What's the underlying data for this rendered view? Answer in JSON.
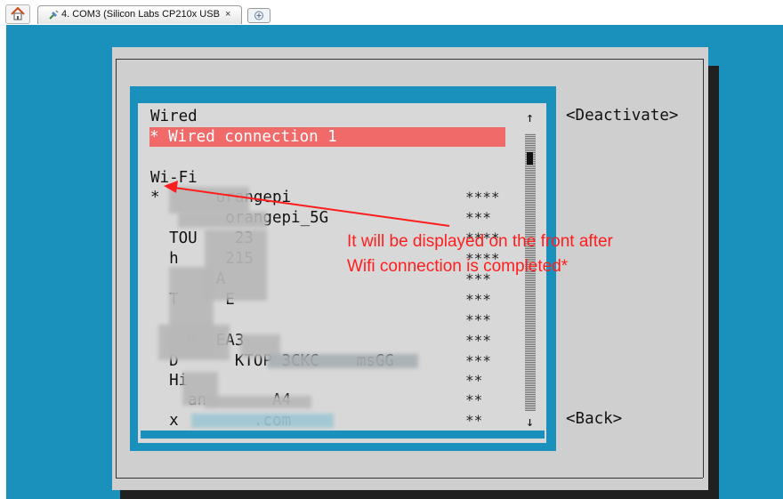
{
  "tabbar": {
    "home_icon": "home-icon",
    "tab_label": "4. COM3  (Silicon Labs CP210x USB",
    "tab_close": "×",
    "new_tab_icon": "new-tab-icon"
  },
  "dialog": {
    "wired_header": "Wired",
    "wired_connection": "* Wired connection 1",
    "wifi_header": "Wi-Fi",
    "networks": [
      {
        "name": "*      orangepi",
        "signal": "****"
      },
      {
        "name": "        orangepi_5G",
        "signal": "***"
      },
      {
        "name": "  TOU    23",
        "signal": "****"
      },
      {
        "name": "  h     215",
        "signal": "****"
      },
      {
        "name": "       A",
        "signal": "***"
      },
      {
        "name": "  T     E",
        "signal": "***"
      },
      {
        "name": "",
        "signal": "***"
      },
      {
        "name": "    R  EA3",
        "signal": "***"
      },
      {
        "name": "  D      KTOP 3CKC    msGG",
        "signal": "***"
      },
      {
        "name": "  Hi",
        "signal": "**"
      },
      {
        "name": "    an       A4",
        "signal": "**"
      },
      {
        "name": "  x        .com",
        "signal": "**"
      }
    ],
    "scroll_up": "↑",
    "scroll_down": "↓",
    "deactivate_button": "<Deactivate>",
    "back_button": "<Back>"
  },
  "annotation": {
    "line1": "It will be displayed on the front after",
    "line2": "Wifi connection is completed*",
    "color": "#ff1e1e"
  },
  "colors": {
    "terminal_bg": "#1a91bd",
    "dialog_bg": "#cfcfcf",
    "selection": "#f06a6a"
  }
}
